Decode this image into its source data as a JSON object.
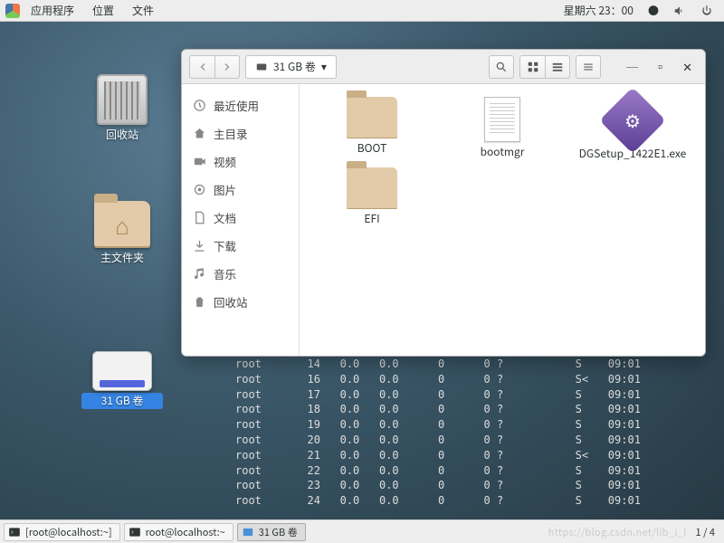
{
  "panel": {
    "menus": [
      "应用程序",
      "位置",
      "文件"
    ],
    "clock": "星期六 23：00"
  },
  "desktop": {
    "trash": "回收站",
    "home": "主文件夹",
    "volume": "31 GB 卷"
  },
  "fm": {
    "location": "31 GB 卷",
    "sidebar": [
      {
        "icon": "clock",
        "label": "最近使用"
      },
      {
        "icon": "home",
        "label": "主目录"
      },
      {
        "icon": "video",
        "label": "视频"
      },
      {
        "icon": "photo",
        "label": "图片"
      },
      {
        "icon": "doc",
        "label": "文档"
      },
      {
        "icon": "download",
        "label": "下载"
      },
      {
        "icon": "music",
        "label": "音乐"
      },
      {
        "icon": "trash",
        "label": "回收站"
      }
    ],
    "files": [
      {
        "type": "folder",
        "name": "BOOT"
      },
      {
        "type": "doc",
        "name": "bootmgr"
      },
      {
        "type": "exe",
        "name": "DGSetup_1422E1.exe"
      },
      {
        "type": "folder",
        "name": "EFI"
      }
    ]
  },
  "terminal": {
    "rows": [
      {
        "user": "root",
        "c2": "14",
        "c3": "0.0",
        "c4": "0.0",
        "c5": "0",
        "c6": "0",
        "c7": "?",
        "c8": "S",
        "c9": "09:01"
      },
      {
        "user": "root",
        "c2": "16",
        "c3": "0.0",
        "c4": "0.0",
        "c5": "0",
        "c6": "0",
        "c7": "?",
        "c8": "S<",
        "c9": "09:01"
      },
      {
        "user": "root",
        "c2": "17",
        "c3": "0.0",
        "c4": "0.0",
        "c5": "0",
        "c6": "0",
        "c7": "?",
        "c8": "S",
        "c9": "09:01"
      },
      {
        "user": "root",
        "c2": "18",
        "c3": "0.0",
        "c4": "0.0",
        "c5": "0",
        "c6": "0",
        "c7": "?",
        "c8": "S",
        "c9": "09:01"
      },
      {
        "user": "root",
        "c2": "19",
        "c3": "0.0",
        "c4": "0.0",
        "c5": "0",
        "c6": "0",
        "c7": "?",
        "c8": "S",
        "c9": "09:01"
      },
      {
        "user": "root",
        "c2": "20",
        "c3": "0.0",
        "c4": "0.0",
        "c5": "0",
        "c6": "0",
        "c7": "?",
        "c8": "S",
        "c9": "09:01"
      },
      {
        "user": "root",
        "c2": "21",
        "c3": "0.0",
        "c4": "0.0",
        "c5": "0",
        "c6": "0",
        "c7": "?",
        "c8": "S<",
        "c9": "09:01"
      },
      {
        "user": "root",
        "c2": "22",
        "c3": "0.0",
        "c4": "0.0",
        "c5": "0",
        "c6": "0",
        "c7": "?",
        "c8": "S",
        "c9": "09:01"
      },
      {
        "user": "root",
        "c2": "23",
        "c3": "0.0",
        "c4": "0.0",
        "c5": "0",
        "c6": "0",
        "c7": "?",
        "c8": "S",
        "c9": "09:01"
      },
      {
        "user": "root",
        "c2": "24",
        "c3": "0.0",
        "c4": "0.0",
        "c5": "0",
        "c6": "0",
        "c7": "?",
        "c8": "S",
        "c9": "09:01"
      }
    ]
  },
  "taskbar": {
    "tasks": [
      {
        "label": "[root@localhost:~]",
        "icon": "term",
        "active": false
      },
      {
        "label": "root@localhost:~",
        "icon": "term",
        "active": false
      },
      {
        "label": "31 GB 卷",
        "icon": "files",
        "active": true
      }
    ],
    "pager": "1 / 4",
    "watermark": "https://blog.csdn.net/lib_i_l"
  }
}
